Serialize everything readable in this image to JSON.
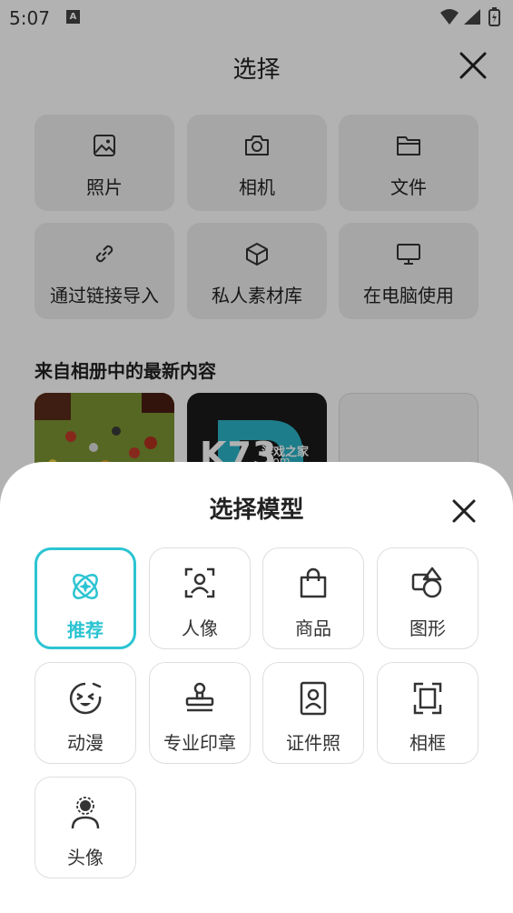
{
  "status_bar": {
    "time": "5:07",
    "notif_letter": "A"
  },
  "picker": {
    "title": "选择",
    "sources": [
      {
        "label": "照片",
        "icon": "image-icon"
      },
      {
        "label": "相机",
        "icon": "camera-icon"
      },
      {
        "label": "文件",
        "icon": "folder-icon"
      },
      {
        "label": "通过链接导入",
        "icon": "link-icon"
      },
      {
        "label": "私人素材库",
        "icon": "cube-icon"
      },
      {
        "label": "在电脑使用",
        "icon": "monitor-icon"
      }
    ],
    "recent_title": "来自相册中的最新内容",
    "watermark": {
      "brand": "K73",
      "line1": "游戏之家",
      "line2": ".com"
    }
  },
  "sheet": {
    "title": "选择模型",
    "models": [
      {
        "label": "推荐",
        "icon": "atom-sparkle-icon",
        "selected": true
      },
      {
        "label": "人像",
        "icon": "portrait-frame-icon",
        "selected": false
      },
      {
        "label": "商品",
        "icon": "shopping-bag-icon",
        "selected": false
      },
      {
        "label": "图形",
        "icon": "shapes-icon",
        "selected": false
      },
      {
        "label": "动漫",
        "icon": "anime-face-icon",
        "selected": false
      },
      {
        "label": "专业印章",
        "icon": "stamp-icon",
        "selected": false
      },
      {
        "label": "证件照",
        "icon": "id-photo-icon",
        "selected": false
      },
      {
        "label": "相框",
        "icon": "frame-icon",
        "selected": false
      },
      {
        "label": "头像",
        "icon": "avatar-icon",
        "selected": false
      }
    ]
  },
  "colors": {
    "accent": "#2cc4d2",
    "tile_bg": "#eeeeee",
    "overlay": "rgba(0,0,0,0.30)"
  }
}
